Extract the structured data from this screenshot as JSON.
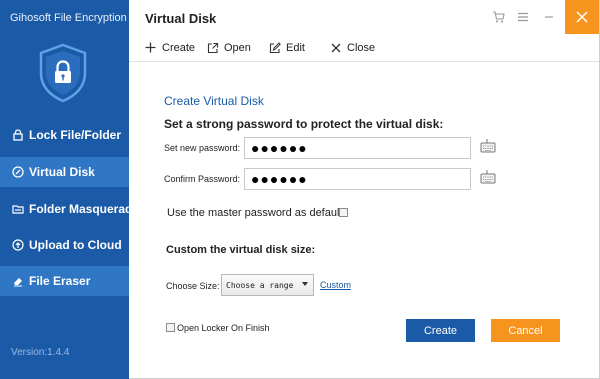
{
  "app": {
    "title": "Gihosoft File Encryption",
    "version": "Version:1.4.4"
  },
  "sidebar": {
    "items": [
      {
        "label": "Lock File/Folder",
        "icon": "lock-icon"
      },
      {
        "label": "Virtual Disk",
        "icon": "disk-icon",
        "active": true
      },
      {
        "label": "Folder Masquerade",
        "icon": "folder-masquerade-icon"
      },
      {
        "label": "Upload to Cloud",
        "icon": "cloud-upload-icon"
      },
      {
        "label": "File Eraser",
        "icon": "eraser-icon"
      }
    ]
  },
  "header": {
    "title": "Virtual Disk"
  },
  "toolbar": {
    "create_label": "Create",
    "open_label": "Open",
    "edit_label": "Edit",
    "close_label": "Close"
  },
  "form": {
    "section_title": "Create Virtual Disk",
    "subtitle": "Set a strong password to protect the virtual disk:",
    "new_password_label": "Set new password:",
    "new_password_value": "●●●●●●",
    "confirm_password_label": "Confirm Password:",
    "confirm_password_value": "●●●●●●",
    "master_password_label": "Use the master password as default",
    "master_password_checked": false,
    "size_title": "Custom the virtual disk size:",
    "choose_size_label": "Choose Size:",
    "choose_size_value": "Choose a range",
    "custom_link": "Custom",
    "open_locker_label": "Open Locker On Finish",
    "open_locker_checked": false,
    "create_button": "Create",
    "cancel_button": "Cancel"
  },
  "colors": {
    "sidebar_bg": "#1a5aa6",
    "sidebar_active": "#2f76c4",
    "accent_orange": "#f7941d",
    "primary_blue": "#1a5aa6"
  }
}
